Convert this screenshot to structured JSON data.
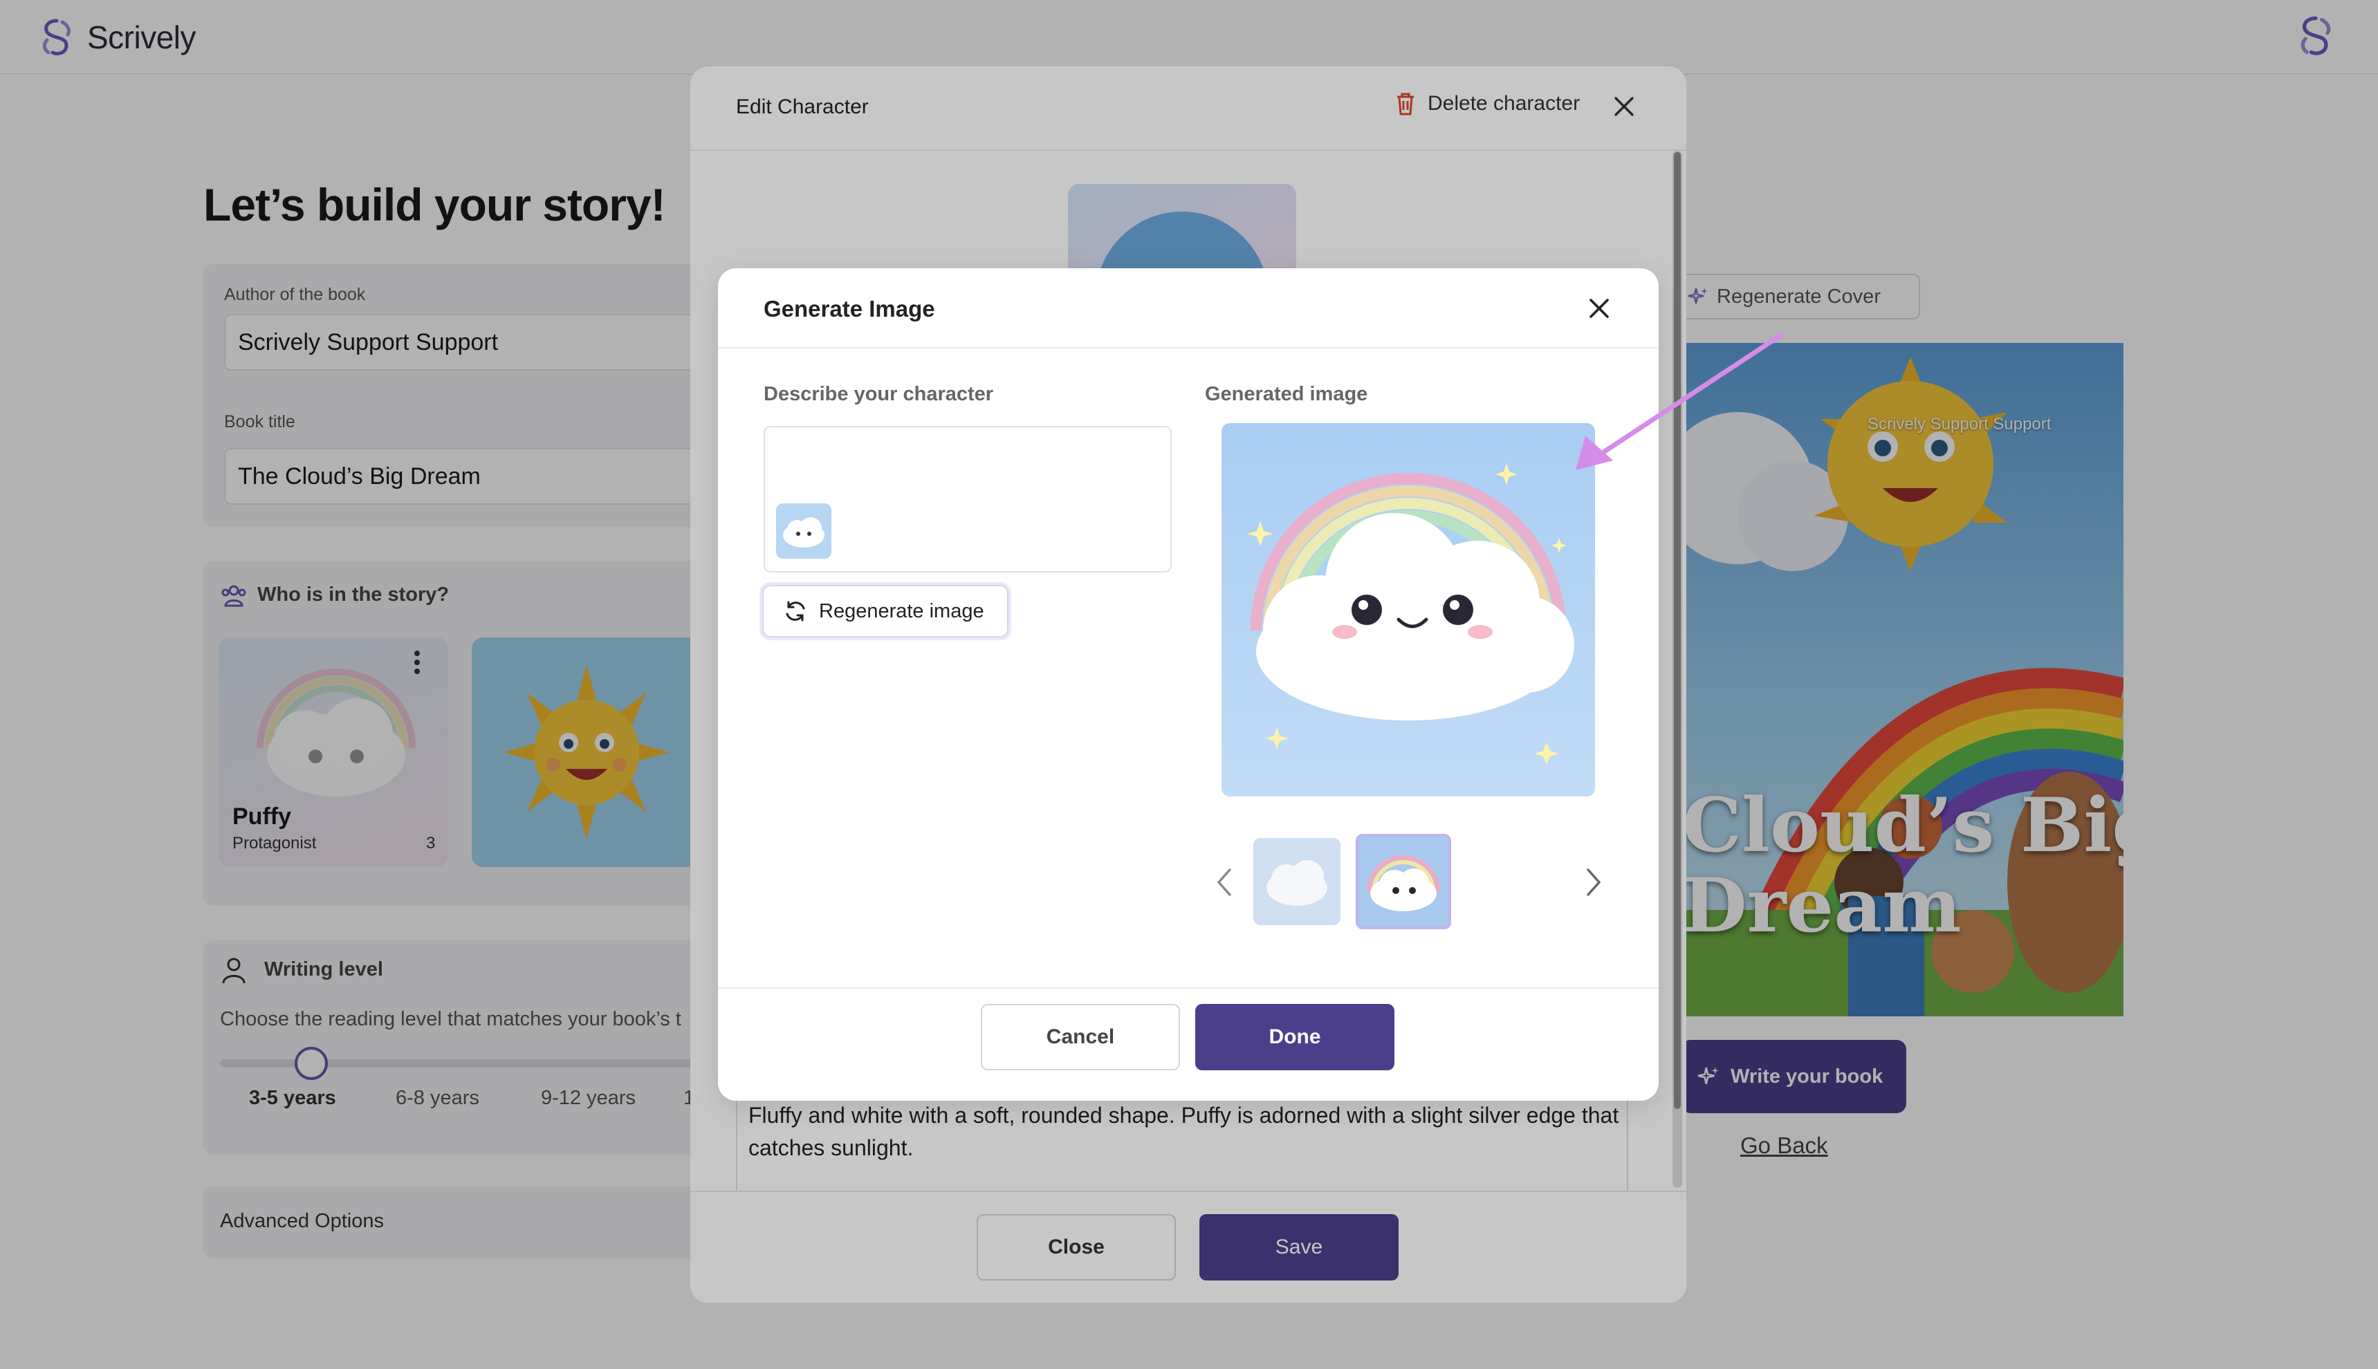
{
  "app": {
    "name": "Scrively"
  },
  "page": {
    "title": "Let’s build your story!"
  },
  "author": {
    "label": "Author of the book",
    "value": "Scrively Support Support"
  },
  "book_title": {
    "label": "Book title",
    "value": "The Cloud’s Big Dream"
  },
  "characters": {
    "heading": "Who is in the story?",
    "items": [
      {
        "name": "Puffy",
        "role": "Protagonist",
        "count": "3"
      }
    ]
  },
  "writing_level": {
    "heading": "Writing level",
    "description": "Choose the reading level that matches your book’s t",
    "levels": [
      "3-5 years",
      "6-8 years",
      "9-12 years",
      "1"
    ],
    "selected": "3-5 years"
  },
  "advanced": {
    "label": "Advanced Options"
  },
  "cover": {
    "regenerate_label": "Regenerate Cover",
    "author_overlay": "Scrively Support Support",
    "title_line1": "Cloud’s Big",
    "title_line2": "Dream"
  },
  "actions": {
    "write_label": "Write your book",
    "go_back_label": "Go Back"
  },
  "edit_modal": {
    "title": "Edit Character",
    "delete_label": "Delete character",
    "description": "Fluffy and white with a soft, rounded shape. Puffy is adorned with a slight silver edge that catches sunlight.",
    "close_label": "Close",
    "save_label": "Save"
  },
  "gen_modal": {
    "title": "Generate Image",
    "describe_label": "Describe your character",
    "generated_label": "Generated image",
    "regenerate_label": "Regenerate image",
    "cancel_label": "Cancel",
    "done_label": "Done"
  },
  "colors": {
    "brand": "#4b3f8c",
    "accent": "#6b55b4",
    "annotation_arrow": "#d58ce8"
  },
  "icons": [
    "scrively-logo-icon",
    "trash-icon",
    "close-icon",
    "sparkle-icon",
    "refresh-icon",
    "chevron-left-icon",
    "chevron-right-icon",
    "users-icon",
    "person-icon",
    "more-vertical-icon"
  ]
}
